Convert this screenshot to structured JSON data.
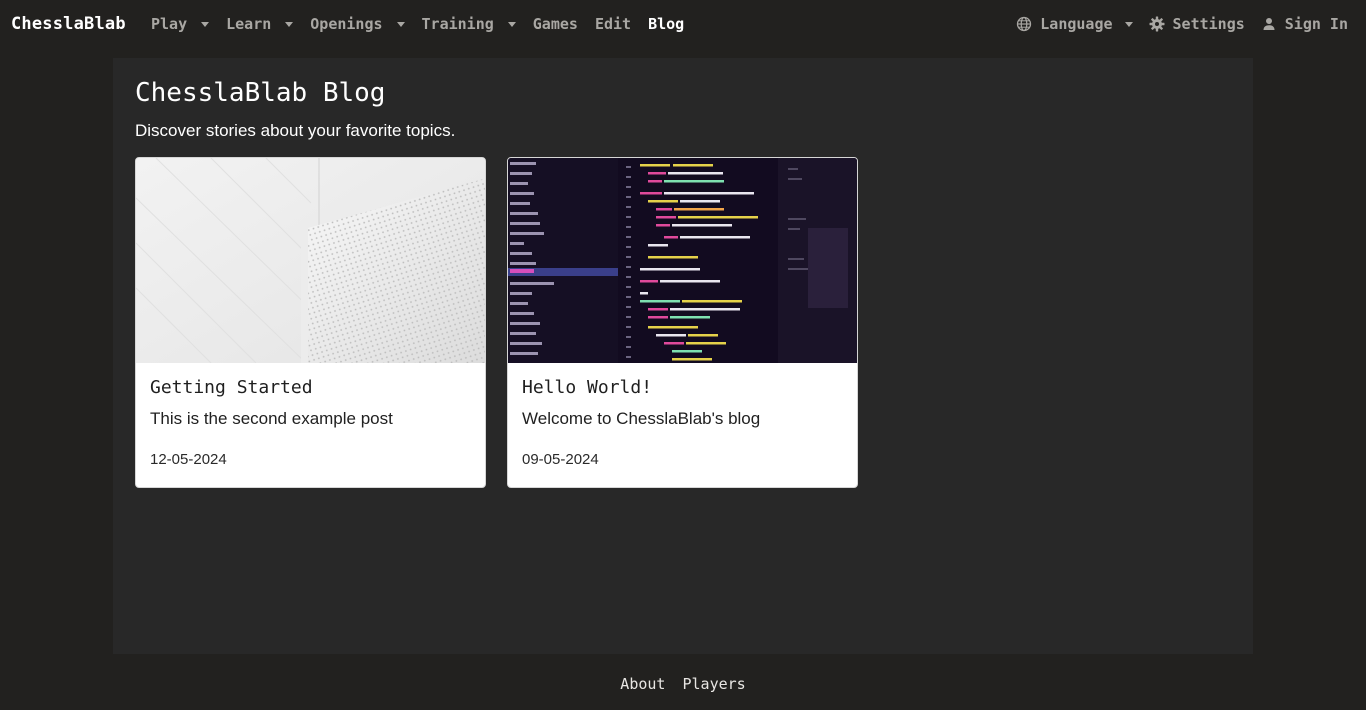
{
  "navbar": {
    "brand": "ChesslaBlab",
    "items": [
      {
        "label": "Play",
        "dropdown": true
      },
      {
        "label": "Learn",
        "dropdown": true
      },
      {
        "label": "Openings",
        "dropdown": true
      },
      {
        "label": "Training",
        "dropdown": true
      },
      {
        "label": "Games",
        "dropdown": false
      },
      {
        "label": "Edit",
        "dropdown": false
      },
      {
        "label": "Blog",
        "dropdown": false,
        "active": true
      }
    ],
    "right": {
      "language": "Language",
      "settings": "Settings",
      "sign_in": "Sign In"
    }
  },
  "main": {
    "title": "ChesslaBlab Blog",
    "subtitle": "Discover stories about your favorite topics."
  },
  "posts": [
    {
      "title": "Getting Started",
      "description": "This is the second example post",
      "date": "12-05-2024",
      "image_icon": "white-architecture-image"
    },
    {
      "title": "Hello World!",
      "description": "Welcome to ChesslaBlab's blog",
      "date": "09-05-2024",
      "image_icon": "code-editor-image"
    }
  ],
  "footer": {
    "links": [
      "About",
      "Players"
    ]
  },
  "colors": {
    "background": "#22211f",
    "content_background": "#282828",
    "card_background": "#ffffff",
    "nav_text": "#a9a7a3",
    "nav_active": "#ffffff"
  }
}
